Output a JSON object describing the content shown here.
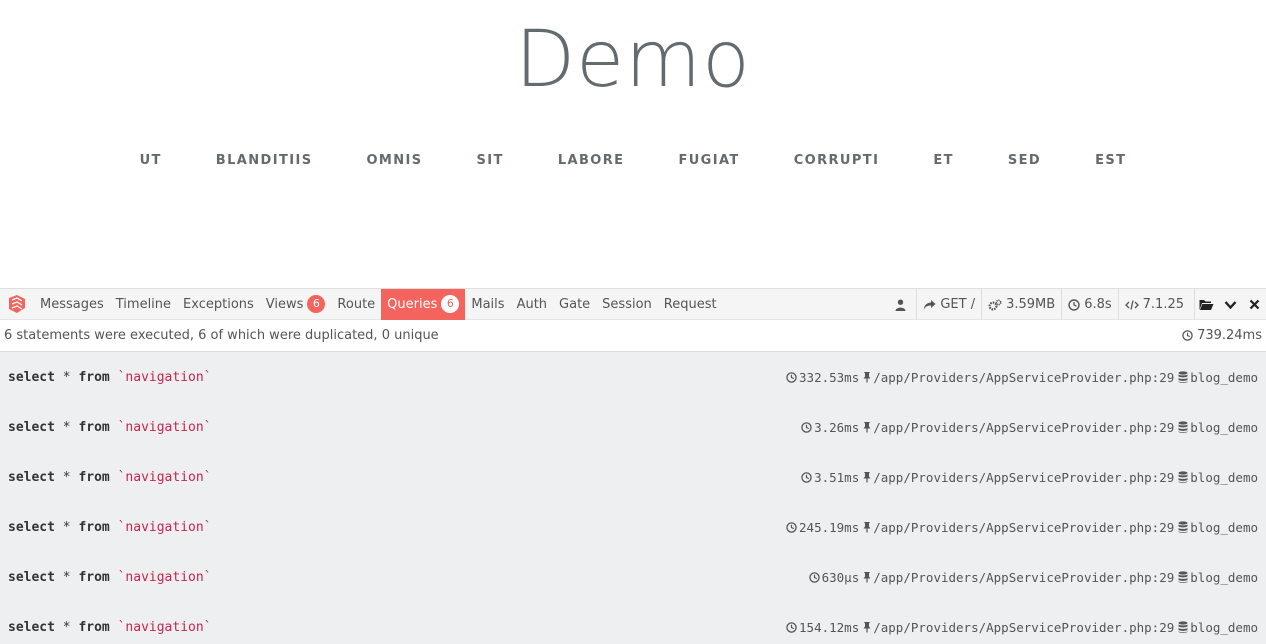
{
  "site": {
    "title": "Demo",
    "nav": [
      "UT",
      "BLANDITIIS",
      "OMNIS",
      "SIT",
      "LABORE",
      "FUGIAT",
      "CORRUPTI",
      "ET",
      "SED",
      "EST"
    ]
  },
  "debugbar": {
    "tabs": [
      {
        "label": "Messages",
        "badge": null,
        "active": false
      },
      {
        "label": "Timeline",
        "badge": null,
        "active": false
      },
      {
        "label": "Exceptions",
        "badge": null,
        "active": false
      },
      {
        "label": "Views",
        "badge": "6",
        "active": false
      },
      {
        "label": "Route",
        "badge": null,
        "active": false
      },
      {
        "label": "Queries",
        "badge": "6",
        "active": true
      },
      {
        "label": "Mails",
        "badge": null,
        "active": false
      },
      {
        "label": "Auth",
        "badge": null,
        "active": false
      },
      {
        "label": "Gate",
        "badge": null,
        "active": false
      },
      {
        "label": "Session",
        "badge": null,
        "active": false
      },
      {
        "label": "Request",
        "badge": null,
        "active": false
      }
    ],
    "indicators": {
      "method": "GET /",
      "memory": "3.59MB",
      "time": "6.8s",
      "version": "7.1.25"
    },
    "colors": {
      "accent": "#f4645f",
      "keyword_table": "#c7254e"
    },
    "queries_panel": {
      "summary": "6 statements were executed, 6 of which were duplicated, 0 unique",
      "total_time": "739.24ms",
      "rows": [
        {
          "kw1": "select",
          "star": "*",
          "kw2": "from",
          "table": "`navigation`",
          "duration": "332.53ms",
          "source": "/app/Providers/AppServiceProvider.php:29",
          "connection": "blog_demo"
        },
        {
          "kw1": "select",
          "star": "*",
          "kw2": "from",
          "table": "`navigation`",
          "duration": "3.26ms",
          "source": "/app/Providers/AppServiceProvider.php:29",
          "connection": "blog_demo"
        },
        {
          "kw1": "select",
          "star": "*",
          "kw2": "from",
          "table": "`navigation`",
          "duration": "3.51ms",
          "source": "/app/Providers/AppServiceProvider.php:29",
          "connection": "blog_demo"
        },
        {
          "kw1": "select",
          "star": "*",
          "kw2": "from",
          "table": "`navigation`",
          "duration": "245.19ms",
          "source": "/app/Providers/AppServiceProvider.php:29",
          "connection": "blog_demo"
        },
        {
          "kw1": "select",
          "star": "*",
          "kw2": "from",
          "table": "`navigation`",
          "duration": "630μs",
          "source": "/app/Providers/AppServiceProvider.php:29",
          "connection": "blog_demo"
        },
        {
          "kw1": "select",
          "star": "*",
          "kw2": "from",
          "table": "`navigation`",
          "duration": "154.12ms",
          "source": "/app/Providers/AppServiceProvider.php:29",
          "connection": "blog_demo"
        }
      ]
    }
  }
}
